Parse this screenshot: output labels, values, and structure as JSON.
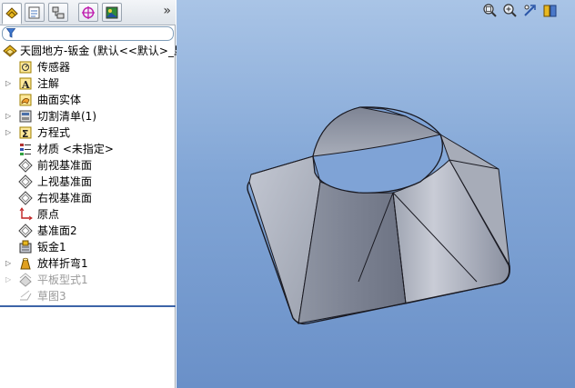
{
  "feature_tree": {
    "root_label": "天圆地方-钣金 (默认<<默认>_显",
    "items": [
      {
        "label": "传感器",
        "icon": "sensor-icon",
        "expandable": false
      },
      {
        "label": "注解",
        "icon": "annotation-icon",
        "expandable": true
      },
      {
        "label": "曲面实体",
        "icon": "surface-body-icon",
        "expandable": false
      },
      {
        "label": "切割清单(1)",
        "icon": "cut-list-icon",
        "expandable": true
      },
      {
        "label": "方程式",
        "icon": "equations-icon",
        "expandable": true
      },
      {
        "label": "材质 <未指定>",
        "icon": "material-icon",
        "expandable": false
      },
      {
        "label": "前视基准面",
        "icon": "plane-icon",
        "expandable": false
      },
      {
        "label": "上视基准面",
        "icon": "plane-icon",
        "expandable": false
      },
      {
        "label": "右视基准面",
        "icon": "plane-icon",
        "expandable": false
      },
      {
        "label": "原点",
        "icon": "origin-icon",
        "expandable": false
      },
      {
        "label": "基准面2",
        "icon": "plane-icon",
        "expandable": false
      },
      {
        "label": "钣金1",
        "icon": "sheet-metal-icon",
        "expandable": false
      },
      {
        "label": "放样折弯1",
        "icon": "lofted-bend-icon",
        "expandable": true
      },
      {
        "label": "平板型式1",
        "icon": "flat-pattern-icon",
        "expandable": true,
        "suppressed": true
      },
      {
        "label": "草图3",
        "icon": "sketch-icon",
        "expandable": false,
        "suppressed": true
      }
    ]
  },
  "panel_tabs": [
    "feature-manager-tab",
    "property-manager-tab",
    "configuration-manager-tab",
    "dimxpert-tab",
    "display-manager-tab"
  ],
  "tabs_more_label": "»",
  "view_toolbar": [
    "zoom-to-fit-icon",
    "zoom-to-area-icon",
    "previous-view-icon",
    "section-view-icon"
  ],
  "colors": {
    "viewport_top": "#a9c4e6",
    "viewport_bottom": "#6a90c8",
    "part_light": "#b7bcc8",
    "part_mid": "#9aa0ad",
    "part_dark": "#6f7484",
    "part_edge": "#1a1a22"
  }
}
